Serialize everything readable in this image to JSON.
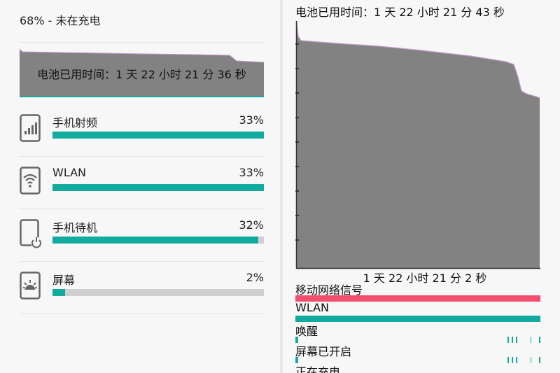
{
  "left": {
    "status": "68% - 未在充电",
    "graph_label": "电池已用时间：1 天 22 小时 21 分 36 秒",
    "items": [
      {
        "name": "手机射频",
        "percent": "33%",
        "fraction": 1.0,
        "icon": "cellular-signal-icon"
      },
      {
        "name": "WLAN",
        "percent": "33%",
        "fraction": 1.0,
        "icon": "wifi-icon"
      },
      {
        "name": "手机待机",
        "percent": "32%",
        "fraction": 0.97,
        "icon": "phone-standby-icon"
      },
      {
        "name": "屏幕",
        "percent": "2%",
        "fraction": 0.06,
        "icon": "screen-brightness-icon"
      }
    ]
  },
  "right": {
    "title": "电池已用时间：1 天 22 小时 21 分 43 秒",
    "time_label": "1 天 22 小时 21 分 2 秒",
    "signals": [
      {
        "label": "移动网络信号",
        "color": "#f24e6e"
      },
      {
        "label": "WLAN",
        "color": "#14ab9f"
      },
      {
        "label": "唤醒",
        "color": "#14ab9f"
      },
      {
        "label": "屏幕已开启",
        "color": "#14ab9f"
      },
      {
        "label": "正在充电",
        "color": "#14ab9f"
      }
    ]
  },
  "colors": {
    "accent": "#14ab9f",
    "graph_fill": "#828282",
    "graph_line": "#c59ad0",
    "mobile_signal": "#f24e6e"
  }
}
